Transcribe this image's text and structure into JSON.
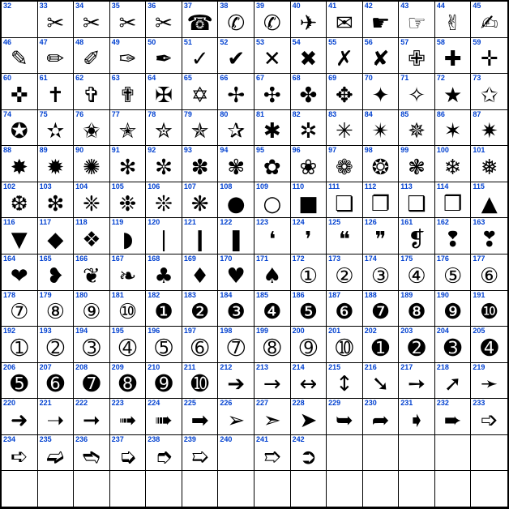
{
  "meta": {
    "columns": 14,
    "rows": 14,
    "first_code": 32
  },
  "cells": [
    {
      "code": 32,
      "glyph": ""
    },
    {
      "code": 33,
      "glyph": "✂"
    },
    {
      "code": 34,
      "glyph": "✂"
    },
    {
      "code": 35,
      "glyph": "✂"
    },
    {
      "code": 36,
      "glyph": "✂"
    },
    {
      "code": 37,
      "glyph": "☎"
    },
    {
      "code": 38,
      "glyph": "✆"
    },
    {
      "code": 39,
      "glyph": "✆"
    },
    {
      "code": 40,
      "glyph": "✈"
    },
    {
      "code": 41,
      "glyph": "✉"
    },
    {
      "code": 42,
      "glyph": "☛"
    },
    {
      "code": 43,
      "glyph": "☞"
    },
    {
      "code": 44,
      "glyph": "✌"
    },
    {
      "code": 45,
      "glyph": "✍"
    },
    {
      "code": 46,
      "glyph": "✎"
    },
    {
      "code": 47,
      "glyph": "✏"
    },
    {
      "code": 48,
      "glyph": "✐"
    },
    {
      "code": 49,
      "glyph": "✑"
    },
    {
      "code": 50,
      "glyph": "✒"
    },
    {
      "code": 51,
      "glyph": "✓"
    },
    {
      "code": 52,
      "glyph": "✔"
    },
    {
      "code": 53,
      "glyph": "✕"
    },
    {
      "code": 54,
      "glyph": "✖"
    },
    {
      "code": 55,
      "glyph": "✗"
    },
    {
      "code": 56,
      "glyph": "✘"
    },
    {
      "code": 57,
      "glyph": "✙"
    },
    {
      "code": 58,
      "glyph": "✚"
    },
    {
      "code": 59,
      "glyph": "✛"
    },
    {
      "code": 60,
      "glyph": "✜"
    },
    {
      "code": 61,
      "glyph": "✝"
    },
    {
      "code": 62,
      "glyph": "✞"
    },
    {
      "code": 63,
      "glyph": "✟"
    },
    {
      "code": 64,
      "glyph": "✠"
    },
    {
      "code": 65,
      "glyph": "✡"
    },
    {
      "code": 66,
      "glyph": "✢"
    },
    {
      "code": 67,
      "glyph": "✣"
    },
    {
      "code": 68,
      "glyph": "✤"
    },
    {
      "code": 69,
      "glyph": "✥"
    },
    {
      "code": 70,
      "glyph": "✦"
    },
    {
      "code": 71,
      "glyph": "✧"
    },
    {
      "code": 72,
      "glyph": "★"
    },
    {
      "code": 73,
      "glyph": "✩"
    },
    {
      "code": 74,
      "glyph": "✪"
    },
    {
      "code": 75,
      "glyph": "✫"
    },
    {
      "code": 76,
      "glyph": "✬"
    },
    {
      "code": 77,
      "glyph": "✭"
    },
    {
      "code": 78,
      "glyph": "✮"
    },
    {
      "code": 79,
      "glyph": "✯"
    },
    {
      "code": 80,
      "glyph": "✰"
    },
    {
      "code": 81,
      "glyph": "✱"
    },
    {
      "code": 82,
      "glyph": "✲"
    },
    {
      "code": 83,
      "glyph": "✳"
    },
    {
      "code": 84,
      "glyph": "✴"
    },
    {
      "code": 85,
      "glyph": "✵"
    },
    {
      "code": 86,
      "glyph": "✶"
    },
    {
      "code": 87,
      "glyph": "✷"
    },
    {
      "code": 88,
      "glyph": "✸"
    },
    {
      "code": 89,
      "glyph": "✹"
    },
    {
      "code": 90,
      "glyph": "✺"
    },
    {
      "code": 91,
      "glyph": "✻"
    },
    {
      "code": 92,
      "glyph": "✼"
    },
    {
      "code": 93,
      "glyph": "✽"
    },
    {
      "code": 94,
      "glyph": "✾"
    },
    {
      "code": 95,
      "glyph": "✿"
    },
    {
      "code": 96,
      "glyph": "❀"
    },
    {
      "code": 97,
      "glyph": "❁"
    },
    {
      "code": 98,
      "glyph": "❂"
    },
    {
      "code": 99,
      "glyph": "❃"
    },
    {
      "code": 100,
      "glyph": "❄"
    },
    {
      "code": 101,
      "glyph": "❅"
    },
    {
      "code": 102,
      "glyph": "❆"
    },
    {
      "code": 103,
      "glyph": "❇"
    },
    {
      "code": 104,
      "glyph": "❈"
    },
    {
      "code": 105,
      "glyph": "❉"
    },
    {
      "code": 106,
      "glyph": "❊"
    },
    {
      "code": 107,
      "glyph": "❋"
    },
    {
      "code": 108,
      "glyph": "●"
    },
    {
      "code": 109,
      "glyph": "○"
    },
    {
      "code": 110,
      "glyph": "■"
    },
    {
      "code": 111,
      "glyph": "❏"
    },
    {
      "code": 112,
      "glyph": "❐"
    },
    {
      "code": 113,
      "glyph": "❑"
    },
    {
      "code": 114,
      "glyph": "❒"
    },
    {
      "code": 115,
      "glyph": "▲"
    },
    {
      "code": 116,
      "glyph": "▼"
    },
    {
      "code": 117,
      "glyph": "◆"
    },
    {
      "code": 118,
      "glyph": "❖"
    },
    {
      "code": 119,
      "glyph": "◗"
    },
    {
      "code": 120,
      "glyph": "❘"
    },
    {
      "code": 121,
      "glyph": "❙"
    },
    {
      "code": 122,
      "glyph": "❚"
    },
    {
      "code": 123,
      "glyph": "❛"
    },
    {
      "code": 124,
      "glyph": "❜"
    },
    {
      "code": 125,
      "glyph": "❝"
    },
    {
      "code": 126,
      "glyph": "❞"
    },
    {
      "code": 161,
      "glyph": "❡"
    },
    {
      "code": 162,
      "glyph": "❢"
    },
    {
      "code": 163,
      "glyph": "❣"
    },
    {
      "code": 164,
      "glyph": "❤"
    },
    {
      "code": 165,
      "glyph": "❥"
    },
    {
      "code": 166,
      "glyph": "❦"
    },
    {
      "code": 167,
      "glyph": "❧"
    },
    {
      "code": 168,
      "glyph": "♣"
    },
    {
      "code": 169,
      "glyph": "♦"
    },
    {
      "code": 170,
      "glyph": "♥"
    },
    {
      "code": 171,
      "glyph": "♠"
    },
    {
      "code": 172,
      "glyph": "①"
    },
    {
      "code": 173,
      "glyph": "②"
    },
    {
      "code": 174,
      "glyph": "③"
    },
    {
      "code": 175,
      "glyph": "④"
    },
    {
      "code": 176,
      "glyph": "⑤"
    },
    {
      "code": 177,
      "glyph": "⑥"
    },
    {
      "code": 178,
      "glyph": "⑦"
    },
    {
      "code": 179,
      "glyph": "⑧"
    },
    {
      "code": 180,
      "glyph": "⑨"
    },
    {
      "code": 181,
      "glyph": "⑩"
    },
    {
      "code": 182,
      "glyph": "❶"
    },
    {
      "code": 183,
      "glyph": "❷"
    },
    {
      "code": 184,
      "glyph": "❸"
    },
    {
      "code": 185,
      "glyph": "❹"
    },
    {
      "code": 186,
      "glyph": "❺"
    },
    {
      "code": 187,
      "glyph": "❻"
    },
    {
      "code": 188,
      "glyph": "❼"
    },
    {
      "code": 189,
      "glyph": "❽"
    },
    {
      "code": 190,
      "glyph": "❾"
    },
    {
      "code": 191,
      "glyph": "❿"
    },
    {
      "code": 192,
      "glyph": "➀"
    },
    {
      "code": 193,
      "glyph": "➁"
    },
    {
      "code": 194,
      "glyph": "➂"
    },
    {
      "code": 195,
      "glyph": "➃"
    },
    {
      "code": 196,
      "glyph": "➄"
    },
    {
      "code": 197,
      "glyph": "➅"
    },
    {
      "code": 198,
      "glyph": "➆"
    },
    {
      "code": 199,
      "glyph": "➇"
    },
    {
      "code": 200,
      "glyph": "➈"
    },
    {
      "code": 201,
      "glyph": "➉"
    },
    {
      "code": 202,
      "glyph": "➊"
    },
    {
      "code": 203,
      "glyph": "➋"
    },
    {
      "code": 204,
      "glyph": "➌"
    },
    {
      "code": 205,
      "glyph": "➍"
    },
    {
      "code": 206,
      "glyph": "➎"
    },
    {
      "code": 207,
      "glyph": "➏"
    },
    {
      "code": 208,
      "glyph": "➐"
    },
    {
      "code": 209,
      "glyph": "➑"
    },
    {
      "code": 210,
      "glyph": "➒"
    },
    {
      "code": 211,
      "glyph": "➓"
    },
    {
      "code": 212,
      "glyph": "➔"
    },
    {
      "code": 213,
      "glyph": "→"
    },
    {
      "code": 214,
      "glyph": "↔"
    },
    {
      "code": 215,
      "glyph": "↕"
    },
    {
      "code": 216,
      "glyph": "➘"
    },
    {
      "code": 217,
      "glyph": "➙"
    },
    {
      "code": 218,
      "glyph": "➚"
    },
    {
      "code": 219,
      "glyph": "➛"
    },
    {
      "code": 220,
      "glyph": "➜"
    },
    {
      "code": 221,
      "glyph": "➝"
    },
    {
      "code": 222,
      "glyph": "➞"
    },
    {
      "code": 223,
      "glyph": "➟"
    },
    {
      "code": 224,
      "glyph": "➠"
    },
    {
      "code": 225,
      "glyph": "➡"
    },
    {
      "code": 226,
      "glyph": "➢"
    },
    {
      "code": 227,
      "glyph": "➣"
    },
    {
      "code": 228,
      "glyph": "➤"
    },
    {
      "code": 229,
      "glyph": "➥"
    },
    {
      "code": 230,
      "glyph": "➦"
    },
    {
      "code": 231,
      "glyph": "➧"
    },
    {
      "code": 232,
      "glyph": "➨"
    },
    {
      "code": 233,
      "glyph": "➩"
    },
    {
      "code": 234,
      "glyph": "➪"
    },
    {
      "code": 235,
      "glyph": "➫"
    },
    {
      "code": 236,
      "glyph": "➬"
    },
    {
      "code": 237,
      "glyph": "➭"
    },
    {
      "code": 238,
      "glyph": "➮"
    },
    {
      "code": 239,
      "glyph": "➯"
    },
    {
      "code": 240,
      "glyph": ""
    },
    {
      "code": 241,
      "glyph": "➱"
    },
    {
      "code": 242,
      "glyph": "➲"
    },
    {
      "code": null,
      "glyph": ""
    },
    {
      "code": null,
      "glyph": ""
    },
    {
      "code": null,
      "glyph": ""
    },
    {
      "code": null,
      "glyph": ""
    },
    {
      "code": null,
      "glyph": ""
    },
    {
      "code": null,
      "glyph": ""
    },
    {
      "code": null,
      "glyph": ""
    },
    {
      "code": null,
      "glyph": ""
    },
    {
      "code": null,
      "glyph": ""
    },
    {
      "code": null,
      "glyph": ""
    },
    {
      "code": null,
      "glyph": ""
    },
    {
      "code": null,
      "glyph": ""
    },
    {
      "code": null,
      "glyph": ""
    },
    {
      "code": null,
      "glyph": ""
    },
    {
      "code": null,
      "glyph": ""
    },
    {
      "code": null,
      "glyph": ""
    },
    {
      "code": null,
      "glyph": ""
    },
    {
      "code": null,
      "glyph": ""
    },
    {
      "code": null,
      "glyph": ""
    }
  ]
}
